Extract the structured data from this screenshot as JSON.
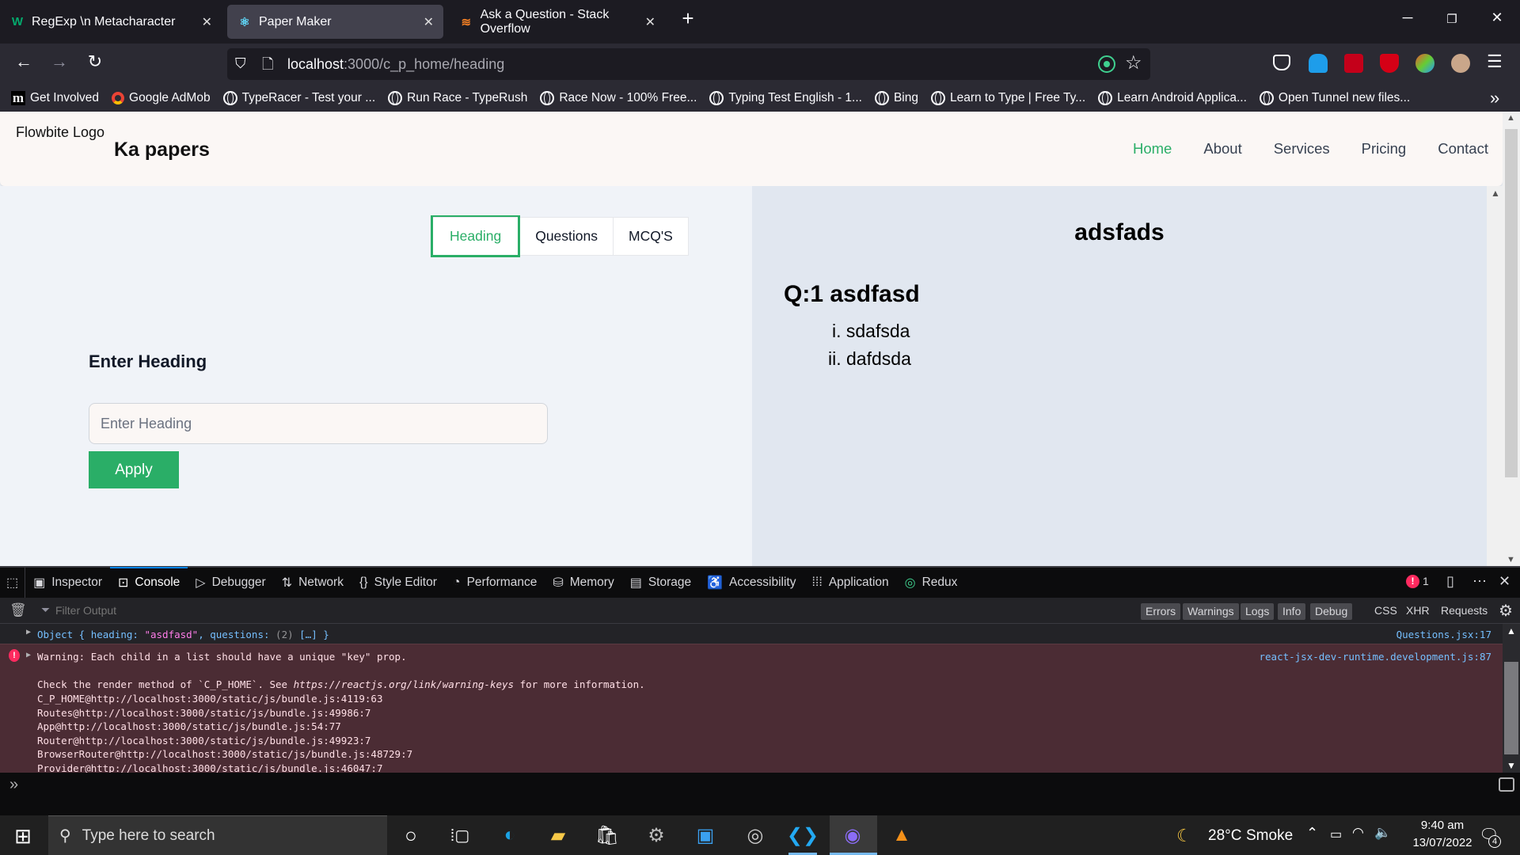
{
  "browser": {
    "tabs": [
      {
        "title": "RegExp \\n Metacharacter",
        "icon": "w3schools-icon",
        "active": false
      },
      {
        "title": "Paper Maker",
        "icon": "react-icon",
        "active": true
      },
      {
        "title": "Ask a Question - Stack Overflow",
        "icon": "stackoverflow-icon",
        "active": false
      }
    ],
    "new_tab_label": "+",
    "url_host": "localhost",
    "url_rest": ":3000/c_p_home/heading",
    "bookmarks": [
      {
        "label": "Get Involved",
        "icon": "m-icon"
      },
      {
        "label": "Google AdMob",
        "icon": "admob-icon"
      },
      {
        "label": "TypeRacer - Test your ...",
        "icon": "globe-icon"
      },
      {
        "label": "Run Race - TypeRush",
        "icon": "globe-icon"
      },
      {
        "label": "Race Now - 100% Free...",
        "icon": "globe-icon"
      },
      {
        "label": "Typing Test English - 1...",
        "icon": "globe-icon"
      },
      {
        "label": "Bing",
        "icon": "globe-icon"
      },
      {
        "label": "Learn to Type | Free Ty...",
        "icon": "globe-icon"
      },
      {
        "label": "Learn Android Applica...",
        "icon": "globe-icon"
      },
      {
        "label": "Open Tunnel new files...",
        "icon": "globe-icon"
      }
    ]
  },
  "page": {
    "logo_text": "Flowbite Logo",
    "brand": "Ka papers",
    "nav": [
      {
        "label": "Home",
        "active": true
      },
      {
        "label": "About",
        "active": false
      },
      {
        "label": "Services",
        "active": false
      },
      {
        "label": "Pricing",
        "active": false
      },
      {
        "label": "Contact",
        "active": false
      }
    ],
    "tabs": [
      {
        "label": "Heading",
        "active": true
      },
      {
        "label": "Questions",
        "active": false
      },
      {
        "label": "MCQ'S",
        "active": false
      }
    ],
    "form": {
      "label": "Enter Heading",
      "input_placeholder": "Enter Heading",
      "input_value": "",
      "apply_label": "Apply"
    },
    "preview": {
      "title": "adsfads",
      "questions": [
        {
          "label": "Q:1 asdfasd",
          "options": [
            {
              "marker": "i.",
              "text": "sdafsda"
            },
            {
              "marker": "ii.",
              "text": "dafdsda"
            }
          ]
        }
      ]
    },
    "accent_color": "#2aae67"
  },
  "devtools": {
    "tabs": [
      {
        "label": "Inspector",
        "icon": "inspector-icon"
      },
      {
        "label": "Console",
        "icon": "console-icon",
        "active": true
      },
      {
        "label": "Debugger",
        "icon": "debugger-icon"
      },
      {
        "label": "Network",
        "icon": "network-icon"
      },
      {
        "label": "Style Editor",
        "icon": "braces-icon"
      },
      {
        "label": "Performance",
        "icon": "performance-icon"
      },
      {
        "label": "Memory",
        "icon": "memory-icon"
      },
      {
        "label": "Storage",
        "icon": "storage-icon"
      },
      {
        "label": "Accessibility",
        "icon": "accessibility-icon"
      },
      {
        "label": "Application",
        "icon": "application-icon"
      },
      {
        "label": "Redux",
        "icon": "redux-icon"
      }
    ],
    "error_count": "1",
    "filter_placeholder": "Filter Output",
    "filter_buttons": [
      "Errors",
      "Warnings",
      "Logs",
      "Info",
      "Debug"
    ],
    "filter_toggles": [
      "CSS",
      "XHR",
      "Requests"
    ],
    "log": {
      "prefix": "Object { heading: ",
      "heading_value": "\"asdfasd\"",
      "middle": ", questions: ",
      "count": "(2)",
      "suffix": " […] }",
      "source": "Questions.jsx:17"
    },
    "warning": {
      "title": "Warning: Each child in a list should have a unique \"key\" prop.",
      "source": "react-jsx-dev-runtime.development.js:87",
      "check_pre": "Check the render method of `C_P_HOME`. See ",
      "check_link": "https://reactjs.org/link/warning-keys",
      "check_post": " for more information.",
      "stack": [
        "C_P_HOME@http://localhost:3000/static/js/bundle.js:4119:63",
        "Routes@http://localhost:3000/static/js/bundle.js:49986:7",
        "App@http://localhost:3000/static/js/bundle.js:54:77",
        "Router@http://localhost:3000/static/js/bundle.js:49923:7",
        "BrowserRouter@http://localhost:3000/static/js/bundle.js:48729:7",
        "Provider@http://localhost:3000/static/js/bundle.js:46047:7"
      ]
    },
    "prompt": "»"
  },
  "taskbar": {
    "search_placeholder": "Type here to search",
    "weather_temp": "28°C",
    "weather_text": "Smoke",
    "time": "9:40 am",
    "date": "13/07/2022",
    "notification_count": "4"
  }
}
